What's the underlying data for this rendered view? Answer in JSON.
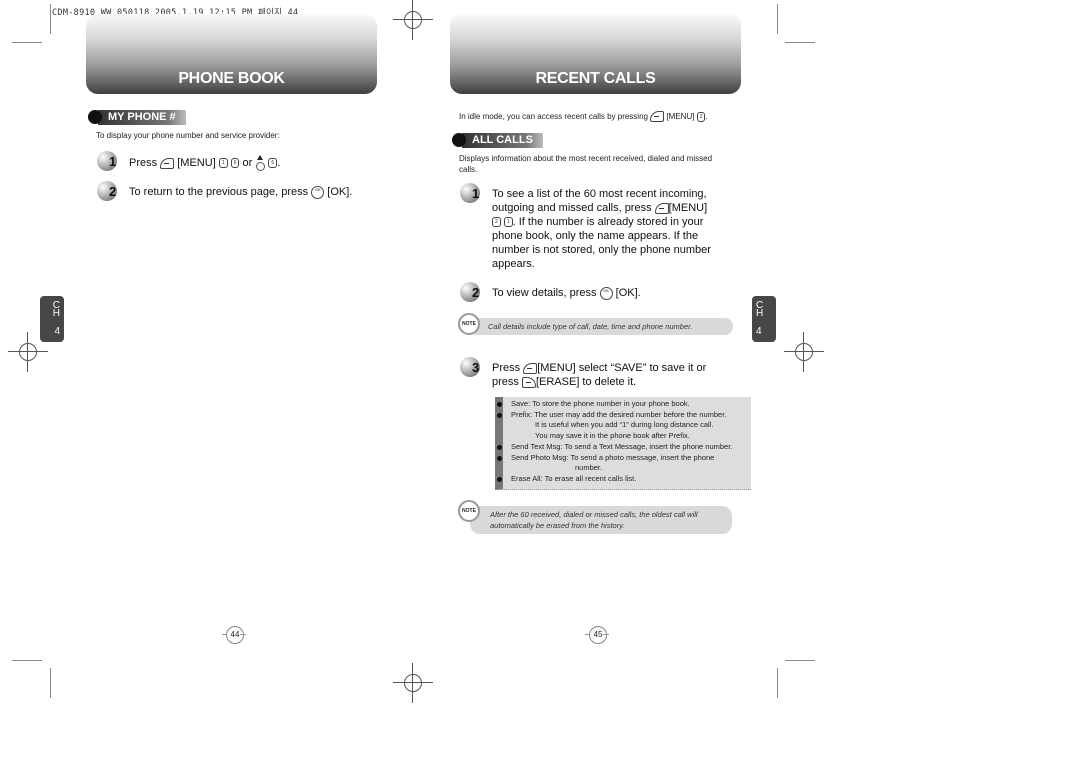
{
  "print_meta": "CDM-8910_WW_050118  2005.1.19 12:15 PM 페이지 44",
  "left_page": {
    "header_title": "PHONE BOOK",
    "section_title": "MY PHONE #",
    "intro": "To display your phone number and service provider:",
    "steps": [
      {
        "num": "1",
        "parts": [
          "Press",
          "[MENU]",
          "or",
          "."
        ],
        "keys": [
          "softkey-left",
          "1-key",
          "6-key",
          "nav-up",
          "6-key"
        ]
      },
      {
        "num": "2",
        "text_before": "To return to the previous page, press",
        "text_after": "[OK]."
      }
    ],
    "chapter_tab": {
      "c": "C",
      "h": "H",
      "num": "4"
    },
    "page_number": "44"
  },
  "right_page": {
    "header_title": "RECENT CALLS",
    "intro_before": "In idle mode, you can access recent calls by pressing",
    "intro_menu": "[MENU]",
    "intro_after": ".",
    "section_title": "ALL CALLS",
    "section_desc": "Displays information about the most recent received, dialed and missed calls.",
    "steps": [
      {
        "num": "1",
        "line1": "To see a list of the 60 most recent incoming,",
        "line2_before": "outgoing and missed calls, press",
        "line2_after": "[MENU]",
        "line3_after": ". If the number is already stored in your",
        "line4": "phone book, only the name appears. If the",
        "line5": "number is not stored, only the phone number",
        "line6": "appears."
      },
      {
        "num": "2",
        "text_before": "To view details, press",
        "text_after": "[OK]."
      },
      {
        "num": "3",
        "line1_before": "Press",
        "line1_after": "[MENU] select “SAVE” to save it or",
        "line2_before": "press",
        "line2_after": "[ERASE] to delete it."
      }
    ],
    "note1": "Call details include type of call, date, time and phone number.",
    "note_badge": "NOTE",
    "options": [
      {
        "text": "Save: To store the phone number in your phone book.",
        "bullet": true
      },
      {
        "text": "Prefix: The user may add the desired number before the number.",
        "bullet": true
      },
      {
        "text": "It is useful when you add “1” during long distance call.",
        "bullet": false
      },
      {
        "text": "You may save it in the phone book after Prefix.",
        "bullet": false
      },
      {
        "text": "Send Text Msg: To send a Text Message, insert the phone number.",
        "bullet": true
      },
      {
        "text": "Send Photo Msg: To send a photo message, insert the phone",
        "bullet": true
      },
      {
        "text": "number.",
        "bullet": false,
        "deep": true
      },
      {
        "text": "Erase All: To erase all recent calls list.",
        "bullet": true
      }
    ],
    "note2": "After the 60 received, dialed or missed calls, the oldest call will automatically be erased from the history.",
    "chapter_tab": {
      "c": "C",
      "h": "H",
      "num": "4"
    },
    "page_number": "45"
  },
  "keys": {
    "one": "1",
    "two": "2",
    "six": "6",
    "ok": "OK"
  }
}
